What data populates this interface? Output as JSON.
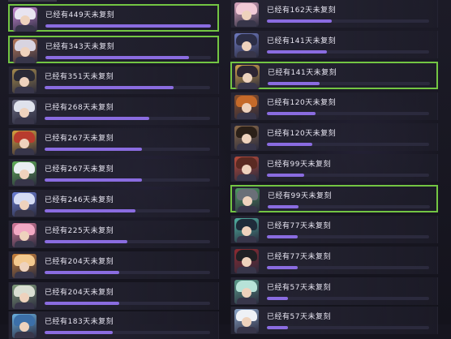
{
  "left_column": {
    "items": [
      {
        "label": "已经有449天未复刻",
        "progress": 1.0,
        "colors": {
          "hair": "#e8e4f0",
          "accent": "#c98ad6"
        }
      },
      {
        "label": "已经有343天未复刻",
        "progress": 0.87,
        "colors": {
          "hair": "#d8d4e0",
          "accent": "#b87a5a"
        }
      },
      {
        "label": "已经有351天未复刻",
        "progress": 0.78,
        "colors": {
          "hair": "#2a2a36",
          "accent": "#a58a4c"
        }
      },
      {
        "label": "已经有268天未复刻",
        "progress": 0.63,
        "colors": {
          "hair": "#dfe2ec",
          "accent": "#6a6a80"
        }
      },
      {
        "label": "已经有267天未复刻",
        "progress": 0.59,
        "colors": {
          "hair": "#b83b2e",
          "accent": "#d9a13d"
        }
      },
      {
        "label": "已经有267天未复刻",
        "progress": 0.59,
        "colors": {
          "hair": "#e9eef2",
          "accent": "#5fae56"
        }
      },
      {
        "label": "已经有246天未复刻",
        "progress": 0.55,
        "colors": {
          "hair": "#d5dcf4",
          "accent": "#6b7fd6"
        }
      },
      {
        "label": "已经有225天未复刻",
        "progress": 0.5,
        "colors": {
          "hair": "#f2a9c4",
          "accent": "#d67a9a"
        }
      },
      {
        "label": "已经有204天未复刻",
        "progress": 0.45,
        "colors": {
          "hair": "#f3c98f",
          "accent": "#c9803a"
        }
      },
      {
        "label": "已经有204天未复刻",
        "progress": 0.45,
        "colors": {
          "hair": "#d9ded2",
          "accent": "#7f9a7a"
        }
      },
      {
        "label": "已经有183天未复刻",
        "progress": 0.41,
        "colors": {
          "hair": "#3c6fa8",
          "accent": "#6ab0e0"
        }
      }
    ]
  },
  "right_column": {
    "items": [
      {
        "label": "已经有162天未复刻",
        "progress": 0.4,
        "colors": {
          "hair": "#f1c9d6",
          "accent": "#d9a6c0"
        }
      },
      {
        "label": "已经有141天未复刻",
        "progress": 0.37,
        "colors": {
          "hair": "#2c2e46",
          "accent": "#6e7ac0"
        }
      },
      {
        "label": "已经有141天未复刻",
        "progress": 0.32,
        "colors": {
          "hair": "#2d2533",
          "accent": "#d2a34c"
        }
      },
      {
        "label": "已经有120天未复刻",
        "progress": 0.3,
        "colors": {
          "hair": "#c56a2a",
          "accent": "#8a4f2a"
        }
      },
      {
        "label": "已经有120天未复刻",
        "progress": 0.28,
        "colors": {
          "hair": "#2b2018",
          "accent": "#8a6a4a"
        }
      },
      {
        "label": "已经有99天未复刻",
        "progress": 0.23,
        "colors": {
          "hair": "#5a2a22",
          "accent": "#b84a3a"
        }
      },
      {
        "label": "已经有99天未复刻",
        "progress": 0.19,
        "colors": {
          "hair": "#6a6f78",
          "accent": "#4f9a62"
        }
      },
      {
        "label": "已经有77天未复刻",
        "progress": 0.19,
        "colors": {
          "hair": "#1f2c3a",
          "accent": "#4fb0a0"
        }
      },
      {
        "label": "已经有77天未复刻",
        "progress": 0.19,
        "colors": {
          "hair": "#202024",
          "accent": "#8e2a30"
        }
      },
      {
        "label": "已经有57天未复刻",
        "progress": 0.13,
        "colors": {
          "hair": "#b7e3d8",
          "accent": "#5a9a8a"
        }
      },
      {
        "label": "已经有57天未复刻",
        "progress": 0.13,
        "colors": {
          "hair": "#eef1f6",
          "accent": "#8aa4c8"
        }
      }
    ]
  },
  "selected_rows": [
    "left-0",
    "left-1",
    "right-2",
    "right-6"
  ],
  "colors": {
    "selection_border": "#73c543",
    "progress_fill": "#8a6ce0"
  }
}
